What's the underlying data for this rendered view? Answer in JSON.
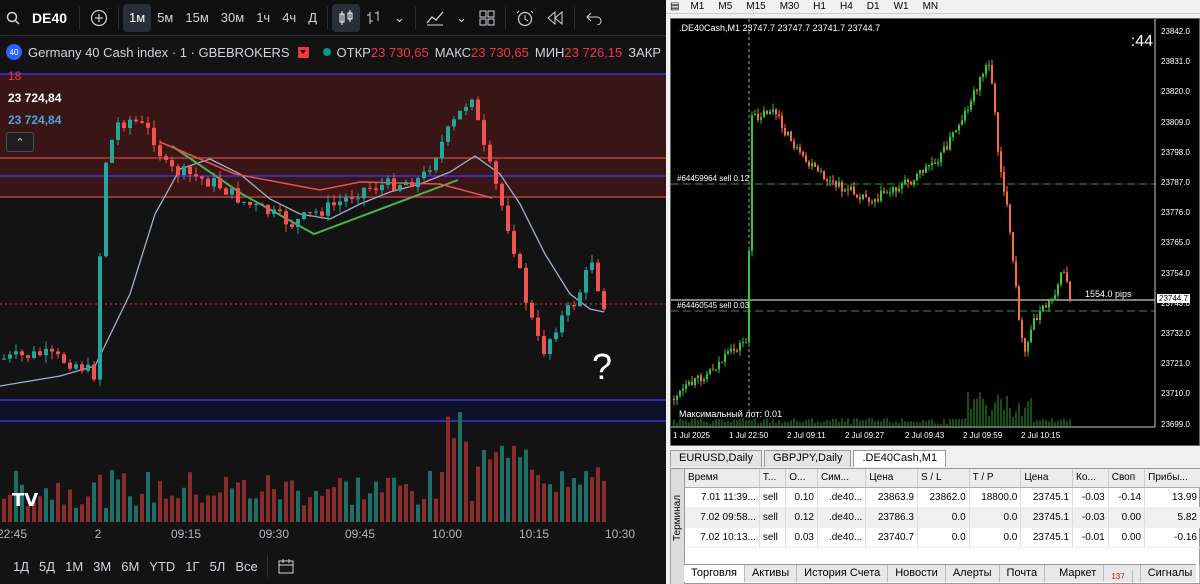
{
  "left_window": {
    "symbol": "DE40",
    "timeframes": [
      "1м",
      "5м",
      "15м",
      "30м",
      "1ч",
      "4ч",
      "Д"
    ],
    "active_timeframe": "1м",
    "legend": {
      "badge": "40",
      "title": "Germany 40 Cash index · 1 · GBEBROKERS",
      "open_label": "ОТКР",
      "open": "23 730,65",
      "high_label": "МАКС",
      "high": "23 730,65",
      "low_label": "МИН",
      "low": "23 726,15",
      "close_label": "ЗАКР"
    },
    "price_label_1": "18",
    "price_label_2": "23 724,84",
    "price_label_3": "23 724,84",
    "time_axis": [
      "22:45",
      "2",
      "09:15",
      "09:30",
      "09:45",
      "10:00",
      "10:15",
      "10:30"
    ],
    "bottom_ranges": [
      "1Д",
      "5Д",
      "1М",
      "3М",
      "6М",
      "YTD",
      "1Г",
      "5Л",
      "Все"
    ],
    "question_mark": "?",
    "logo": "TV"
  },
  "right_window": {
    "timeframes": [
      "M1",
      "M5",
      "M15",
      "M30",
      "H1",
      "H4",
      "D1",
      "W1",
      "MN"
    ],
    "chart_title": ".DE40Cash,M1  23747.7 23747.7 23741.7 23744.7",
    "countdown": ":44",
    "price_ticks": [
      "23842.0",
      "23831.0",
      "23820.0",
      "23809.0",
      "23798.0",
      "23787.0",
      "23776.0",
      "23765.0",
      "23754.0",
      "23743.0",
      "23732.0",
      "23721.0",
      "23710.0",
      "23699.0"
    ],
    "current_price": "23744.7",
    "order_line_1": "#64459964 sell 0.12",
    "order_line_2": "#64460545 sell 0.03",
    "pips_label": "1554.0 pips",
    "max_lot": "Максимальный лот: 0.01",
    "time_labels": [
      "1 Jul 2025",
      "1 Jul 22:50",
      "2 Jul 09:11",
      "2 Jul 09:27",
      "2 Jul 09:43",
      "2 Jul 09:59",
      "2 Jul 10:15"
    ],
    "chart_tabs": [
      "EURUSD,Daily",
      "GBPJPY,Daily",
      ".DE40Cash,M1"
    ],
    "terminal_label": "Терминал",
    "columns": [
      "Время",
      "Т...",
      "О...",
      "Сим...",
      "Цена",
      "S / L",
      "T / P",
      "Цена",
      "Ко...",
      "Своп",
      "Прибы..."
    ],
    "rows": [
      [
        "7.01 11:39...",
        "sell",
        "0.10",
        ".de40...",
        "23863.9",
        "23862.0",
        "18800.0",
        "23745.1",
        "-0.03",
        "-0.14",
        "13.99"
      ],
      [
        "7.02 09:58...",
        "sell",
        "0.12",
        ".de40...",
        "23786.3",
        "0.0",
        "0.0",
        "23745.1",
        "-0.03",
        "0.00",
        "5.82"
      ],
      [
        "7.02 10:13...",
        "sell",
        "0.03",
        ".de40...",
        "23740.7",
        "0.0",
        "0.0",
        "23745.1",
        "-0.01",
        "0.00",
        "-0.16"
      ]
    ],
    "bottom_tabs": [
      "Торговля",
      "Активы",
      "История Счета",
      "Новости",
      "Алерты",
      "Почта",
      "Маркет",
      "Сигналы"
    ],
    "market_badge": "137"
  }
}
